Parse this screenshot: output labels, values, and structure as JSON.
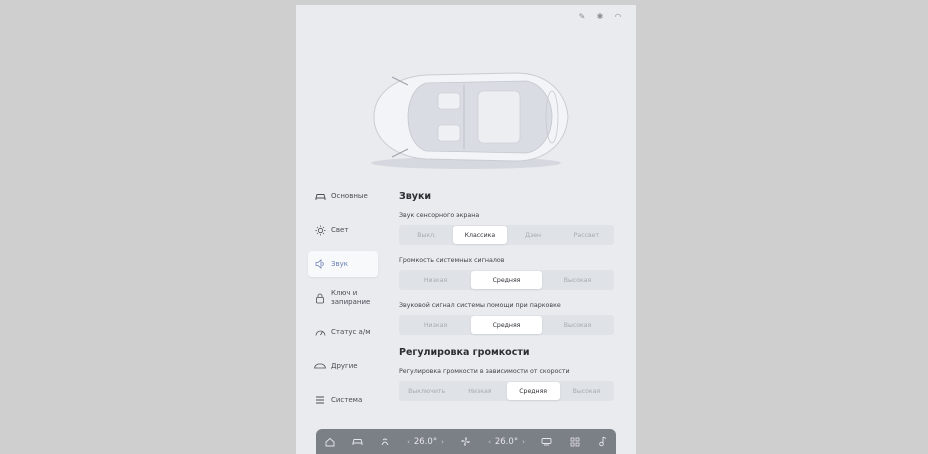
{
  "colors": {
    "page_bg": "#cfcfcf",
    "screen_bg": "#e9ebef",
    "accent": "#6a7fb3",
    "dock_bg": "#7b7f86"
  },
  "status_icons": [
    "edit-icon",
    "bluetooth-icon",
    "wifi-icon"
  ],
  "sidebar": {
    "items": [
      {
        "label": "Основные",
        "icon": "car-icon",
        "active": false
      },
      {
        "label": "Свет",
        "icon": "sun-icon",
        "active": false
      },
      {
        "label": "Звук",
        "icon": "speaker-icon",
        "active": true
      },
      {
        "label": "Ключ и запирание",
        "icon": "lock-icon",
        "active": false
      },
      {
        "label": "Статус а/м",
        "icon": "gauge-icon",
        "active": false
      },
      {
        "label": "Другие",
        "icon": "car-side-icon",
        "active": false
      },
      {
        "label": "Система",
        "icon": "sliders-icon",
        "active": false
      }
    ]
  },
  "sounds": {
    "title": "Звуки",
    "touch_sound": {
      "label": "Звук сенсорного экрана",
      "options": [
        "Выкл.",
        "Классика",
        "Дзен",
        "Рассвет"
      ],
      "selected": "Классика"
    },
    "system_volume": {
      "label": "Громкость системных сигналов",
      "options": [
        "Низкая",
        "Средняя",
        "Высокая"
      ],
      "selected": "Средняя"
    },
    "parking_volume": {
      "label": "Звуковой сигнал системы помощи при парковке",
      "options": [
        "Низкая",
        "Средняя",
        "Высокая"
      ],
      "selected": "Средняя"
    }
  },
  "volume_control": {
    "title": "Регулировка громкости",
    "speed_volume": {
      "label": "Регулировка громкости в зависимости от скорости",
      "options": [
        "Выключить",
        "Низкая",
        "Средняя",
        "Высокая"
      ],
      "selected": "Средняя"
    }
  },
  "dock": {
    "left_temp": "26.0°",
    "right_temp": "26.0°",
    "icons": [
      "home-icon",
      "car-icon",
      "heater-icon",
      "fan-icon",
      "defrost-icon",
      "apps-icon",
      "music-icon"
    ]
  }
}
